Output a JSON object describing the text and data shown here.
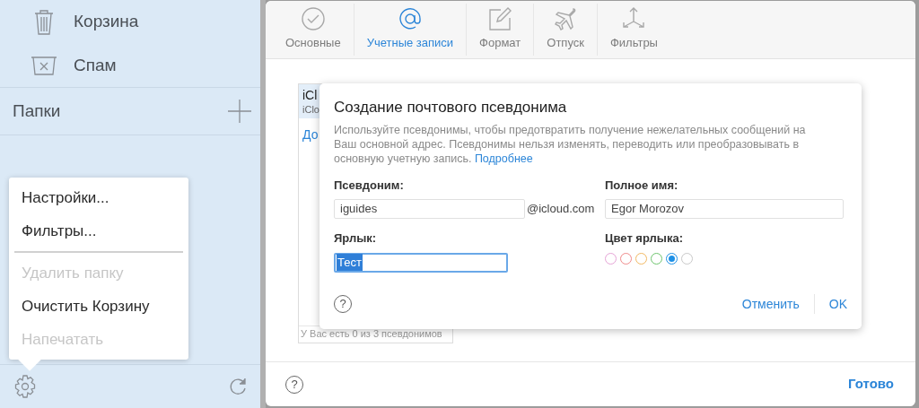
{
  "sidebar": {
    "items": [
      {
        "kind": "trash",
        "label": "Корзина"
      },
      {
        "kind": "spam",
        "label": "Спам"
      }
    ],
    "folders": {
      "label": "Папки"
    }
  },
  "menu": {
    "items": [
      {
        "label": "Настройки...",
        "disabled": false
      },
      {
        "label": "Фильтры...",
        "disabled": false
      },
      {
        "label": "Удалить папку",
        "disabled": true
      },
      {
        "label": "Очистить Корзину",
        "disabled": false
      },
      {
        "label": "Напечатать",
        "disabled": true
      }
    ]
  },
  "tabs": [
    {
      "kind": "general",
      "label": "Основные",
      "selected": false
    },
    {
      "kind": "accounts",
      "label": "Учетные записи",
      "selected": true
    },
    {
      "kind": "format",
      "label": "Формат",
      "selected": false
    },
    {
      "kind": "vacation",
      "label": "Отпуск",
      "selected": false
    },
    {
      "kind": "filters",
      "label": "Фильтры",
      "selected": false
    }
  ],
  "accounts": {
    "title": "iCl",
    "subtitle": "iClo",
    "link": "До",
    "count_note": "У Вас есть 0 из 3 псевдонимов"
  },
  "dialog": {
    "title": "Создание почтового псевдонима",
    "description": "Используйте псевдонимы, чтобы предотвратить получение нежелательных сообщений на Ваш основной адрес. Псевдонимы нельзя изменять, переводить или преобразовывать в основную учетную запись.",
    "more_link": "Подробнее",
    "alias": {
      "label": "Псевдоним:",
      "value": "iguides",
      "domain": "@icloud.com"
    },
    "full_name": {
      "label": "Полное имя:",
      "value": "Egor Morozov"
    },
    "tag": {
      "label": "Ярлык:",
      "value": "Тест"
    },
    "tag_color": {
      "label": "Цвет ярлыка:",
      "options": [
        {
          "color": "#e6a3d6",
          "selected": false
        },
        {
          "color": "#f08a8a",
          "selected": false
        },
        {
          "color": "#f2b860",
          "selected": false
        },
        {
          "color": "#6cc46c",
          "selected": false
        },
        {
          "color": "#1e90e6",
          "selected": true
        },
        {
          "color": "#c8c8c8",
          "selected": false
        }
      ]
    },
    "help": "?",
    "cancel": "Отменить",
    "ok": "OK"
  },
  "footer": {
    "help": "?",
    "done": "Готово"
  }
}
